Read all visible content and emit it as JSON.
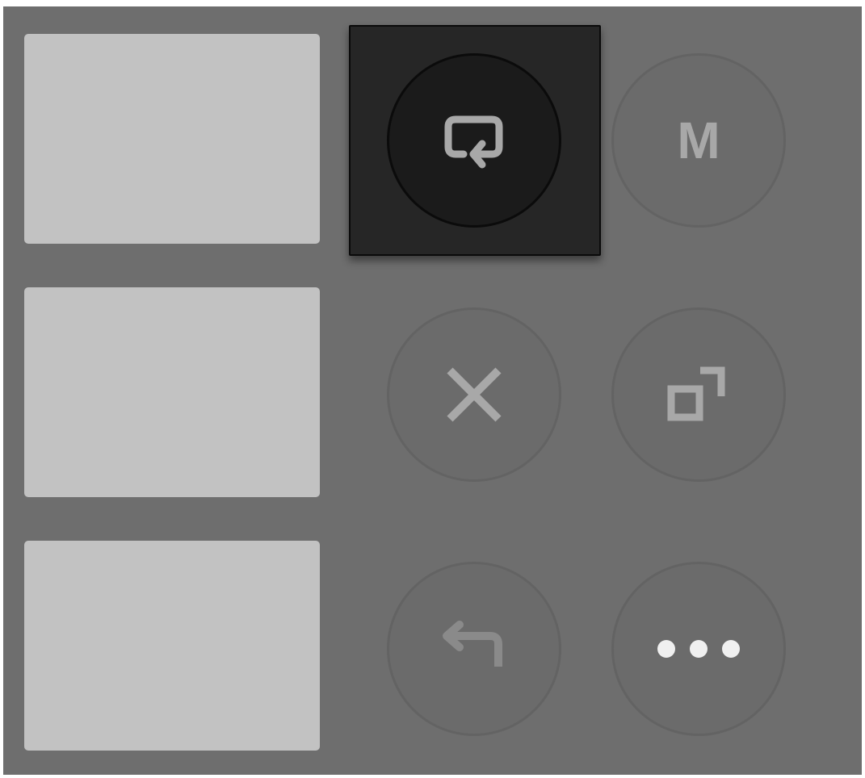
{
  "pads": [
    {
      "label": ""
    },
    {
      "label": ""
    },
    {
      "label": ""
    }
  ],
  "buttons": {
    "loop": {
      "icon": "loop-icon",
      "active": true
    },
    "mute": {
      "icon": "letter-m",
      "label": "M"
    },
    "close": {
      "icon": "close-icon"
    },
    "duplicate": {
      "icon": "duplicate-icon"
    },
    "return": {
      "icon": "return-arrow-icon"
    },
    "more": {
      "icon": "more-dots-icon"
    }
  },
  "colors": {
    "panel": "#6e6e6e",
    "pad": "#c2c2c2",
    "active_box": "#262626",
    "active_button": "#1b1b1b",
    "icon_gray": "#a8a8a8",
    "icon_white": "#f0f0f0"
  }
}
